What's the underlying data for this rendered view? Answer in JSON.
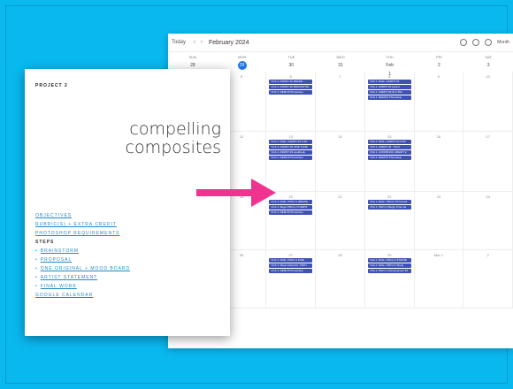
{
  "calendar": {
    "today_label": "Today",
    "month_title": "February 2024",
    "view_label": "Month",
    "week_header": [
      {
        "dow": "SUN",
        "date": "28"
      },
      {
        "dow": "MON",
        "date": "29",
        "today": true
      },
      {
        "dow": "TUE",
        "date": "30"
      },
      {
        "dow": "WED",
        "date": "31"
      },
      {
        "dow": "THU",
        "date": "Feb 1"
      },
      {
        "dow": "FRI",
        "date": "2"
      },
      {
        "dow": "SAT",
        "date": "3"
      }
    ],
    "weeks": [
      {
        "dates": [
          "4",
          "5",
          "6",
          "7",
          "8",
          "9",
          "10"
        ]
      },
      {
        "dates": [
          "11",
          "12",
          "13",
          "14",
          "15",
          "16",
          "17"
        ]
      },
      {
        "dates": [
          "18",
          "19",
          "20",
          "21",
          "22",
          "23",
          "24"
        ]
      },
      {
        "dates": [
          "25",
          "26",
          "27",
          "28",
          "29",
          "Mar 1",
          "2"
        ]
      }
    ],
    "events": {
      "week0_tue": [
        "VCA 1: ASMNT #1 REFER...",
        "VCA 1: ASMNT #2 BRAINSTOR",
        "VCA 1: DEMOS Photoshop"
      ],
      "week0_thu": [
        "VCA 1: DUE • ASMNT #1",
        "VCA 1: ASMNT #1 period",
        "VCA 1: ASMNT #2 IN-CTRL",
        "VCA 1: DEMOS Photoshop"
      ],
      "week1_tue": [
        "VCA 1: DUE • ASMNT #1 & #2",
        "VCA 1: ASMNT #3 FINE TUNE",
        "VCA 1: ASMNT #4 Lookbook",
        "VCA 1: DEMOS Photoshop"
      ],
      "week1_thu": [
        "VCA 1: DUE • ASMNT #2 & #3",
        "VCA 1: ASMNT #4 - Work",
        "VCA 1: LOOKBOOK CREDIT 2",
        "VCA 1: DEMOS Photoshop"
      ],
      "week2_tue": [
        "VCA 1: DUE • PROJ 2 (BRAIN)",
        "VCA 1: Begin PROJ 2 COMPS",
        "VCA 1: DEMOS Photoshop"
      ],
      "week2_thu": [
        "VCA 1: DUE • PROJ 2 Proposal",
        "VCA 1: PROJ 2 Begin Proto 2a"
      ],
      "week3_tue": [
        "VCA 1: DUE • PROJ 2 FINE",
        "VCA 1: Show Artist Ref. PROJ",
        "VCA 1: DEMOS Photoshop"
      ],
      "week3_thu": [
        "VCA 1: DUE • PROJ 2 STRATE",
        "VCA 1: DUE • PROJ 2 Study",
        "VCA 1: PROJ 2 Development #4"
      ],
      "week4_tue": [
        "VCA 1: DUE • PROJ 2 Proposal",
        "VCA 1: DUE • ASMNT #1",
        "VCA 1: PROJ 2 Work",
        "VCA 1: Finalize • PROJ 2"
      ],
      "week4_thu": [
        "VCA 1: DUE • PROJ 2 Proposal"
      ]
    }
  },
  "document": {
    "project_label": "PROJECT 2",
    "title_line1": "compelling",
    "title_line2": "composites",
    "links": [
      "OBJECTIVES",
      "RUBRIC(S) + EXTRA CREDIT",
      "PHOTOSHOP REQUIREMENTS"
    ],
    "steps_heading": "STEPS",
    "steps": [
      "BRAINSTORM",
      "PROPOSAL",
      "ONE ORIGINAL + MOOD BOARD",
      "ARTIST STATEMENT",
      "FINAL WORK"
    ],
    "calendar_link": "GOOGLE CALENDAR"
  },
  "colors": {
    "background": "#0ab8f0",
    "event": "#3f51b5",
    "link": "#1e88c8",
    "arrow": "#f0338e"
  }
}
